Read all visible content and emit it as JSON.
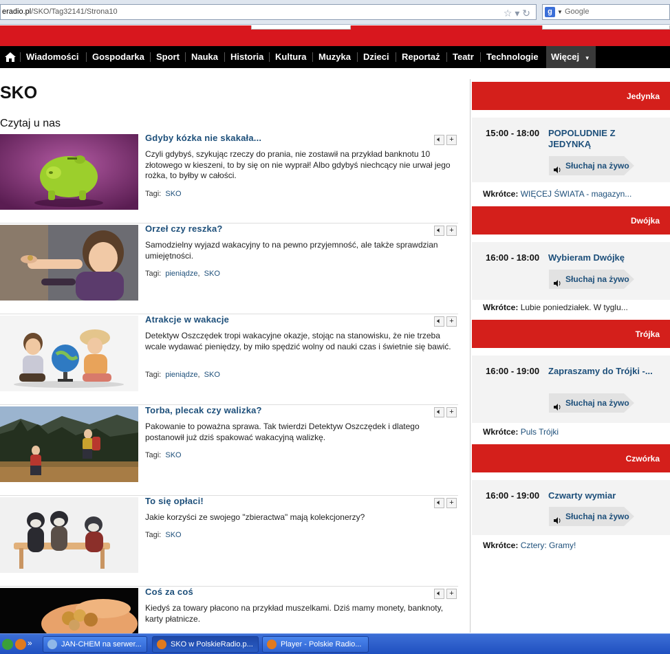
{
  "browser": {
    "url_domain": "eradio.pl",
    "url_path": "/SKO/Tag32141/Strona10",
    "search_placeholder": "Google"
  },
  "nav": {
    "items": [
      "Wiadomości",
      "Gospodarka",
      "Sport",
      "Nauka",
      "Historia",
      "Kultura",
      "Muzyka",
      "Dzieci",
      "Reportaż",
      "Teatr",
      "Technologie"
    ],
    "more_label": "Więcej"
  },
  "page": {
    "title": "SKO",
    "section": "Czytaj u nas"
  },
  "articles": [
    {
      "title": "Gdyby kózka nie skakała...",
      "desc": "Czyli gdybyś, szykując rzeczy do prania, nie zostawił na przykład banknotu 10 złotowego w kieszeni, to by się on nie wyprał! Albo gdybyś niechcący nie urwał jego rożka, to byłby w całości.",
      "tags_label": "Tagi:",
      "tags": [
        "SKO"
      ]
    },
    {
      "title": "Orzeł czy reszka?",
      "desc": "Samodzielny wyjazd wakacyjny to na pewno przyjemność, ale także sprawdzian umiejętności.",
      "tags_label": "Tagi:",
      "tags": [
        "pieniądze",
        "SKO"
      ]
    },
    {
      "title": "Atrakcje w wakacje",
      "desc": "Detektyw Oszczędek tropi wakacyjne okazje, stojąc na stanowisku, że nie trzeba wcale wydawać pieniędzy, by miło spędzić wolny od nauki czas i świetnie się bawić.",
      "tags_label": "Tagi:",
      "tags": [
        "pieniądze",
        "SKO"
      ]
    },
    {
      "title": "Torba, plecak czy walizka?",
      "desc": "Pakowanie to poważna sprawa. Tak twierdzi Detektyw Oszczędek i dlatego postanowił już dziś spakować wakacyjną walizkę.",
      "tags_label": "Tagi:",
      "tags": [
        "SKO"
      ]
    },
    {
      "title": "To się opłaci!",
      "desc": "Jakie korzyści ze swojego \"zbieractwa\" mają kolekcjonerzy?",
      "tags_label": "Tagi:",
      "tags": [
        "SKO"
      ]
    },
    {
      "title": "Coś za coś",
      "desc": "Kiedyś za towary płacono na przykład muszelkami. Dziś mamy monety, banknoty, karty płatnicze.",
      "tags_label": "",
      "tags": []
    }
  ],
  "stations": [
    {
      "name": "Jedynka",
      "time": "15:00 - 18:00",
      "program": "POPOLUDNIE Z JEDYNKĄ",
      "listen": "Słuchaj na żywo",
      "soon_label": "Wkrótce:",
      "soon": "WIĘCEJ ŚWIATA - magazyn..."
    },
    {
      "name": "Dwójka",
      "time": "16:00 - 18:00",
      "program": "Wybieram Dwójkę",
      "listen": "Słuchaj na żywo",
      "soon_label": "Wkrótce:",
      "soon": "Lubie poniedziałek. W tyglu..."
    },
    {
      "name": "Trójka",
      "time": "16:00 - 19:00",
      "program": "Zapraszamy do Trójki -...",
      "listen": "Słuchaj na żywo",
      "soon_label": "Wkrótce:",
      "soon": "Puls Trójki"
    },
    {
      "name": "Czwórka",
      "time": "16:00 - 19:00",
      "program": "Czwarty wymiar",
      "listen": "Słuchaj na żywo",
      "soon_label": "Wkrótce:",
      "soon": "Cztery: Gramy!"
    }
  ],
  "taskbar": {
    "buttons": [
      "JAN-CHEM na serwer...",
      "SKO w PolskieRadio.p...",
      "Player - Polskie Radio..."
    ]
  }
}
